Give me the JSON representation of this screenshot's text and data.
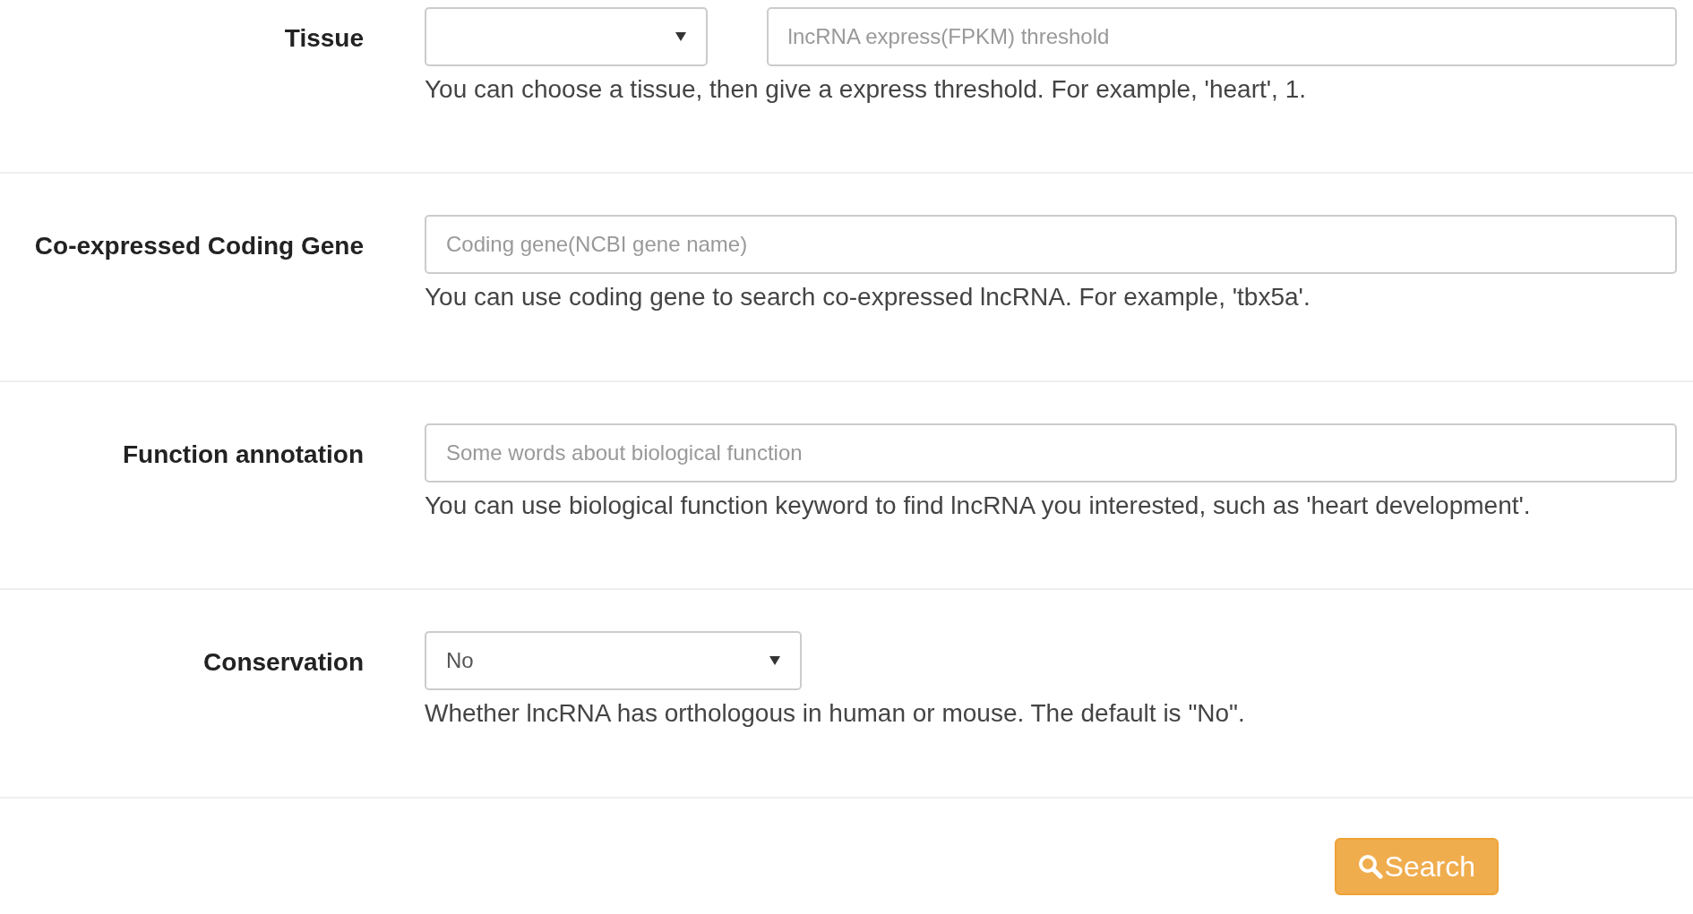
{
  "fields": [
    {
      "kind": "select_threshold",
      "label": "Tissue",
      "threshold_placeholder": "lncRNA express(FPKM) threshold",
      "help": "You can choose a tissue, then give a express threshold. For example, 'heart', 1."
    },
    {
      "kind": "text",
      "label": "Co-expressed Coding Gene",
      "placeholder": "Coding gene(NCBI gene name)",
      "help": "You can use coding gene to search co-expressed lncRNA. For example, 'tbx5a'."
    },
    {
      "kind": "text",
      "label": "Function annotation",
      "placeholder": "Some words about biological function",
      "help": "You can use biological function keyword to find lncRNA you interested, such as 'heart development'."
    },
    {
      "kind": "select",
      "label": "Conservation",
      "value": "No",
      "help": "Whether lncRNA has orthologous in human or mouse. The default is \"No\"."
    }
  ],
  "search_button": "Search"
}
